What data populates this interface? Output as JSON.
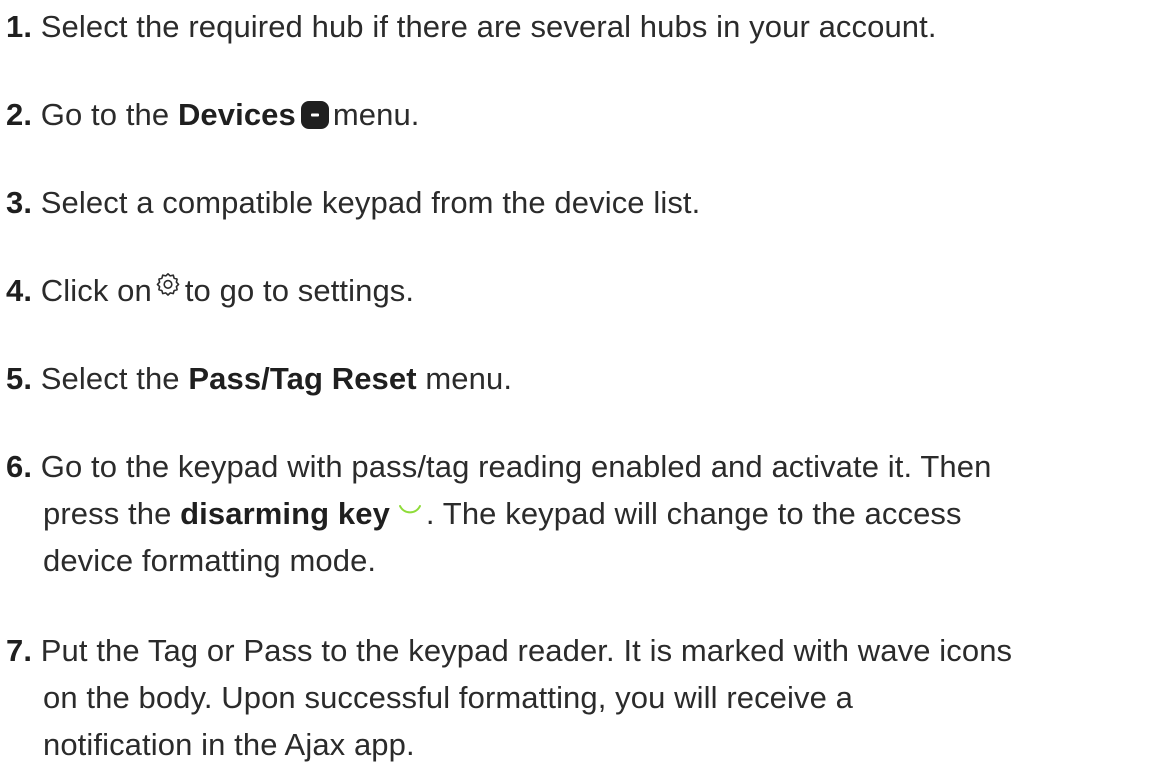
{
  "steps": [
    {
      "num": "1.",
      "text": "Select the required hub if there are several hubs in your account."
    },
    {
      "num": "2.",
      "pre": "Go to the",
      "bold": "Devices",
      "post": "menu.",
      "icon": "devices-icon"
    },
    {
      "num": "3.",
      "text": "Select a compatible keypad from the device list."
    },
    {
      "num": "4.",
      "pre": "Click on",
      "post": "to go to settings.",
      "icon": "gear-icon"
    },
    {
      "num": "5.",
      "pre": "Select the",
      "bold": "Pass/Tag Reset",
      "post": "menu."
    },
    {
      "num": "6.",
      "line1": "Go to the keypad with pass/tag reading enabled and activate it. Then",
      "pre": "press the",
      "bold": "disarming key",
      "post": ". The keypad will change to the access",
      "line3": "device formatting mode.",
      "icon": "disarm-icon"
    },
    {
      "num": "7.",
      "line1": "Put the Tag or Pass to the keypad reader. It is marked with wave icons",
      "line2": "on the body. Upon successful formatting, you will receive a",
      "line3": "notification in the Ajax app."
    }
  ],
  "colors": {
    "text": "#2b2b2b",
    "device_icon": "#1f1f1f",
    "disarm_icon": "#8fdc3a"
  }
}
